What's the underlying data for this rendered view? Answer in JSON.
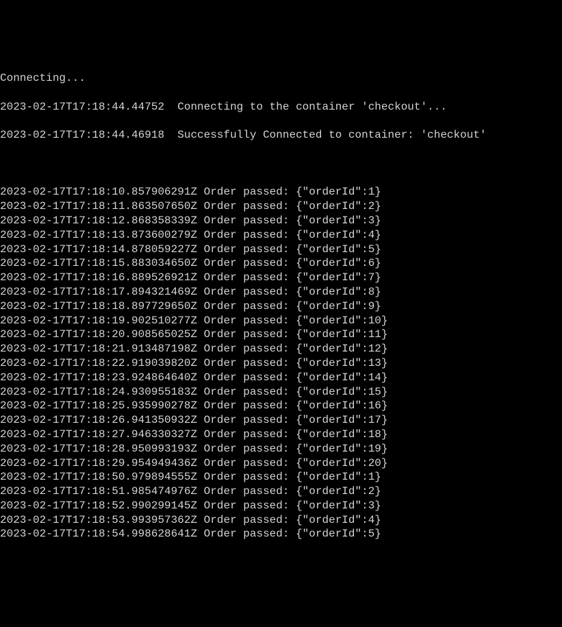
{
  "header": {
    "connecting": "Connecting...",
    "connect_msg": {
      "timestamp": "2023-02-17T17:18:44.44752",
      "spacer": "  ",
      "text": "Connecting to the container 'checkout'..."
    },
    "success_msg": {
      "timestamp": "2023-02-17T17:18:44.46918",
      "spacer": "  ",
      "text": "Successfully Connected to container: 'checkout'"
    }
  },
  "logs": [
    {
      "timestamp": "2023-02-17T17:18:10.857906291Z",
      "text": "Order passed: {\"orderId\":1}"
    },
    {
      "timestamp": "2023-02-17T17:18:11.863507650Z",
      "text": "Order passed: {\"orderId\":2}"
    },
    {
      "timestamp": "2023-02-17T17:18:12.868358339Z",
      "text": "Order passed: {\"orderId\":3}"
    },
    {
      "timestamp": "2023-02-17T17:18:13.873600279Z",
      "text": "Order passed: {\"orderId\":4}"
    },
    {
      "timestamp": "2023-02-17T17:18:14.878059227Z",
      "text": "Order passed: {\"orderId\":5}"
    },
    {
      "timestamp": "2023-02-17T17:18:15.883034650Z",
      "text": "Order passed: {\"orderId\":6}"
    },
    {
      "timestamp": "2023-02-17T17:18:16.889526921Z",
      "text": "Order passed: {\"orderId\":7}"
    },
    {
      "timestamp": "2023-02-17T17:18:17.894321469Z",
      "text": "Order passed: {\"orderId\":8}"
    },
    {
      "timestamp": "2023-02-17T17:18:18.897729650Z",
      "text": "Order passed: {\"orderId\":9}"
    },
    {
      "timestamp": "2023-02-17T17:18:19.902510277Z",
      "text": "Order passed: {\"orderId\":10}"
    },
    {
      "timestamp": "2023-02-17T17:18:20.908565025Z",
      "text": "Order passed: {\"orderId\":11}"
    },
    {
      "timestamp": "2023-02-17T17:18:21.913487198Z",
      "text": "Order passed: {\"orderId\":12}"
    },
    {
      "timestamp": "2023-02-17T17:18:22.919039820Z",
      "text": "Order passed: {\"orderId\":13}"
    },
    {
      "timestamp": "2023-02-17T17:18:23.924864640Z",
      "text": "Order passed: {\"orderId\":14}"
    },
    {
      "timestamp": "2023-02-17T17:18:24.930955183Z",
      "text": "Order passed: {\"orderId\":15}"
    },
    {
      "timestamp": "2023-02-17T17:18:25.935990278Z",
      "text": "Order passed: {\"orderId\":16}"
    },
    {
      "timestamp": "2023-02-17T17:18:26.941350932Z",
      "text": "Order passed: {\"orderId\":17}"
    },
    {
      "timestamp": "2023-02-17T17:18:27.946330327Z",
      "text": "Order passed: {\"orderId\":18}"
    },
    {
      "timestamp": "2023-02-17T17:18:28.950993193Z",
      "text": "Order passed: {\"orderId\":19}"
    },
    {
      "timestamp": "2023-02-17T17:18:29.954949436Z",
      "text": "Order passed: {\"orderId\":20}"
    },
    {
      "timestamp": "2023-02-17T17:18:50.979894555Z",
      "text": "Order passed: {\"orderId\":1}"
    },
    {
      "timestamp": "2023-02-17T17:18:51.985474976Z",
      "text": "Order passed: {\"orderId\":2}"
    },
    {
      "timestamp": "2023-02-17T17:18:52.990299145Z",
      "text": "Order passed: {\"orderId\":3}"
    },
    {
      "timestamp": "2023-02-17T17:18:53.993957362Z",
      "text": "Order passed: {\"orderId\":4}"
    },
    {
      "timestamp": "2023-02-17T17:18:54.998628641Z",
      "text": "Order passed: {\"orderId\":5}"
    }
  ]
}
